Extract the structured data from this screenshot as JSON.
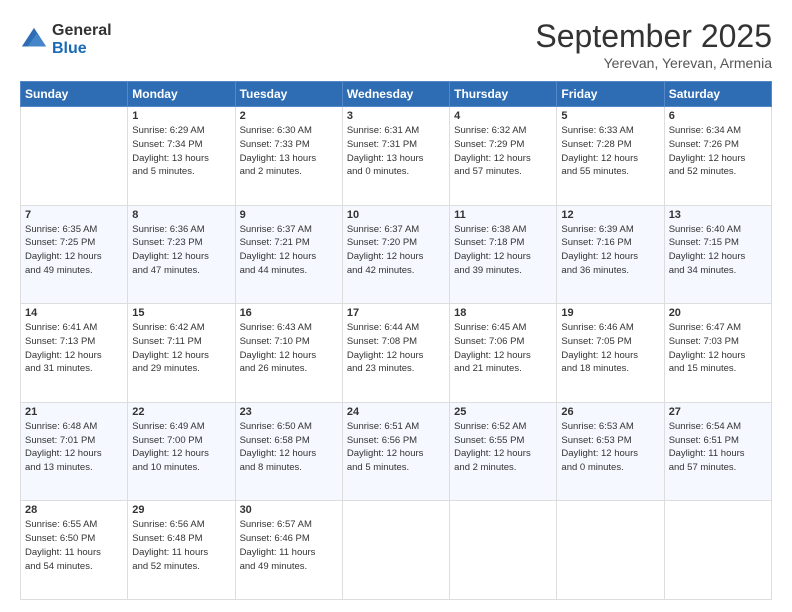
{
  "header": {
    "logo_general": "General",
    "logo_blue": "Blue",
    "month_title": "September 2025",
    "location": "Yerevan, Yerevan, Armenia"
  },
  "weekdays": [
    "Sunday",
    "Monday",
    "Tuesday",
    "Wednesday",
    "Thursday",
    "Friday",
    "Saturday"
  ],
  "weeks": [
    [
      {
        "day": "",
        "info": ""
      },
      {
        "day": "1",
        "info": "Sunrise: 6:29 AM\nSunset: 7:34 PM\nDaylight: 13 hours\nand 5 minutes."
      },
      {
        "day": "2",
        "info": "Sunrise: 6:30 AM\nSunset: 7:33 PM\nDaylight: 13 hours\nand 2 minutes."
      },
      {
        "day": "3",
        "info": "Sunrise: 6:31 AM\nSunset: 7:31 PM\nDaylight: 13 hours\nand 0 minutes."
      },
      {
        "day": "4",
        "info": "Sunrise: 6:32 AM\nSunset: 7:29 PM\nDaylight: 12 hours\nand 57 minutes."
      },
      {
        "day": "5",
        "info": "Sunrise: 6:33 AM\nSunset: 7:28 PM\nDaylight: 12 hours\nand 55 minutes."
      },
      {
        "day": "6",
        "info": "Sunrise: 6:34 AM\nSunset: 7:26 PM\nDaylight: 12 hours\nand 52 minutes."
      }
    ],
    [
      {
        "day": "7",
        "info": "Sunrise: 6:35 AM\nSunset: 7:25 PM\nDaylight: 12 hours\nand 49 minutes."
      },
      {
        "day": "8",
        "info": "Sunrise: 6:36 AM\nSunset: 7:23 PM\nDaylight: 12 hours\nand 47 minutes."
      },
      {
        "day": "9",
        "info": "Sunrise: 6:37 AM\nSunset: 7:21 PM\nDaylight: 12 hours\nand 44 minutes."
      },
      {
        "day": "10",
        "info": "Sunrise: 6:37 AM\nSunset: 7:20 PM\nDaylight: 12 hours\nand 42 minutes."
      },
      {
        "day": "11",
        "info": "Sunrise: 6:38 AM\nSunset: 7:18 PM\nDaylight: 12 hours\nand 39 minutes."
      },
      {
        "day": "12",
        "info": "Sunrise: 6:39 AM\nSunset: 7:16 PM\nDaylight: 12 hours\nand 36 minutes."
      },
      {
        "day": "13",
        "info": "Sunrise: 6:40 AM\nSunset: 7:15 PM\nDaylight: 12 hours\nand 34 minutes."
      }
    ],
    [
      {
        "day": "14",
        "info": "Sunrise: 6:41 AM\nSunset: 7:13 PM\nDaylight: 12 hours\nand 31 minutes."
      },
      {
        "day": "15",
        "info": "Sunrise: 6:42 AM\nSunset: 7:11 PM\nDaylight: 12 hours\nand 29 minutes."
      },
      {
        "day": "16",
        "info": "Sunrise: 6:43 AM\nSunset: 7:10 PM\nDaylight: 12 hours\nand 26 minutes."
      },
      {
        "day": "17",
        "info": "Sunrise: 6:44 AM\nSunset: 7:08 PM\nDaylight: 12 hours\nand 23 minutes."
      },
      {
        "day": "18",
        "info": "Sunrise: 6:45 AM\nSunset: 7:06 PM\nDaylight: 12 hours\nand 21 minutes."
      },
      {
        "day": "19",
        "info": "Sunrise: 6:46 AM\nSunset: 7:05 PM\nDaylight: 12 hours\nand 18 minutes."
      },
      {
        "day": "20",
        "info": "Sunrise: 6:47 AM\nSunset: 7:03 PM\nDaylight: 12 hours\nand 15 minutes."
      }
    ],
    [
      {
        "day": "21",
        "info": "Sunrise: 6:48 AM\nSunset: 7:01 PM\nDaylight: 12 hours\nand 13 minutes."
      },
      {
        "day": "22",
        "info": "Sunrise: 6:49 AM\nSunset: 7:00 PM\nDaylight: 12 hours\nand 10 minutes."
      },
      {
        "day": "23",
        "info": "Sunrise: 6:50 AM\nSunset: 6:58 PM\nDaylight: 12 hours\nand 8 minutes."
      },
      {
        "day": "24",
        "info": "Sunrise: 6:51 AM\nSunset: 6:56 PM\nDaylight: 12 hours\nand 5 minutes."
      },
      {
        "day": "25",
        "info": "Sunrise: 6:52 AM\nSunset: 6:55 PM\nDaylight: 12 hours\nand 2 minutes."
      },
      {
        "day": "26",
        "info": "Sunrise: 6:53 AM\nSunset: 6:53 PM\nDaylight: 12 hours\nand 0 minutes."
      },
      {
        "day": "27",
        "info": "Sunrise: 6:54 AM\nSunset: 6:51 PM\nDaylight: 11 hours\nand 57 minutes."
      }
    ],
    [
      {
        "day": "28",
        "info": "Sunrise: 6:55 AM\nSunset: 6:50 PM\nDaylight: 11 hours\nand 54 minutes."
      },
      {
        "day": "29",
        "info": "Sunrise: 6:56 AM\nSunset: 6:48 PM\nDaylight: 11 hours\nand 52 minutes."
      },
      {
        "day": "30",
        "info": "Sunrise: 6:57 AM\nSunset: 6:46 PM\nDaylight: 11 hours\nand 49 minutes."
      },
      {
        "day": "",
        "info": ""
      },
      {
        "day": "",
        "info": ""
      },
      {
        "day": "",
        "info": ""
      },
      {
        "day": "",
        "info": ""
      }
    ]
  ]
}
